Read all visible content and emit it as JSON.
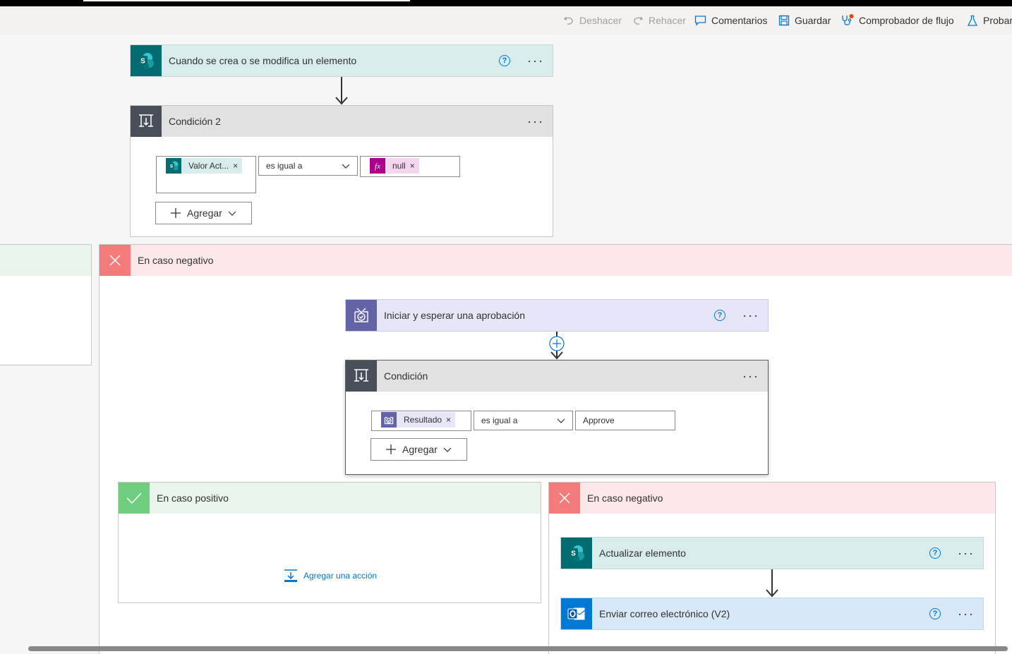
{
  "toolbar": {
    "undo": "Deshacer",
    "redo": "Rehacer",
    "comments": "Comentarios",
    "save": "Guardar",
    "checker": "Comprobador de flujo",
    "test": "Probar"
  },
  "trigger": {
    "title": "Cuando se crea o se modifica un elemento",
    "help": "?",
    "more": "···"
  },
  "condition2": {
    "title": "Condición 2",
    "more": "···",
    "left_token": "Valor Act...",
    "operator": "es igual a",
    "right_token": "null",
    "add": "Agregar",
    "remove": "×"
  },
  "neg_branch": {
    "title": "En caso negativo"
  },
  "approval": {
    "title": "Iniciar y esperar una aprobación",
    "help": "?",
    "more": "···"
  },
  "condition": {
    "title": "Condición",
    "more": "···",
    "left_token": "Resultado",
    "operator": "es igual a",
    "right_value": "Approve",
    "add": "Agregar",
    "remove": "×"
  },
  "inner_pos": {
    "title": "En caso positivo",
    "add_action": "Agregar una acción"
  },
  "inner_neg": {
    "title": "En caso negativo"
  },
  "update_item": {
    "title": "Actualizar elemento",
    "help": "?",
    "more": "···"
  },
  "send_email": {
    "title": "Enviar correo electrónico (V2)",
    "help": "?",
    "more": "···"
  },
  "colors": {
    "sharepoint": "#036c70",
    "condition": "#484f58",
    "approval": "#6264a7",
    "outlook": "#0078d4",
    "negative": "#f37b7b",
    "positive": "#6fce7e",
    "fx": "#ad008c"
  }
}
